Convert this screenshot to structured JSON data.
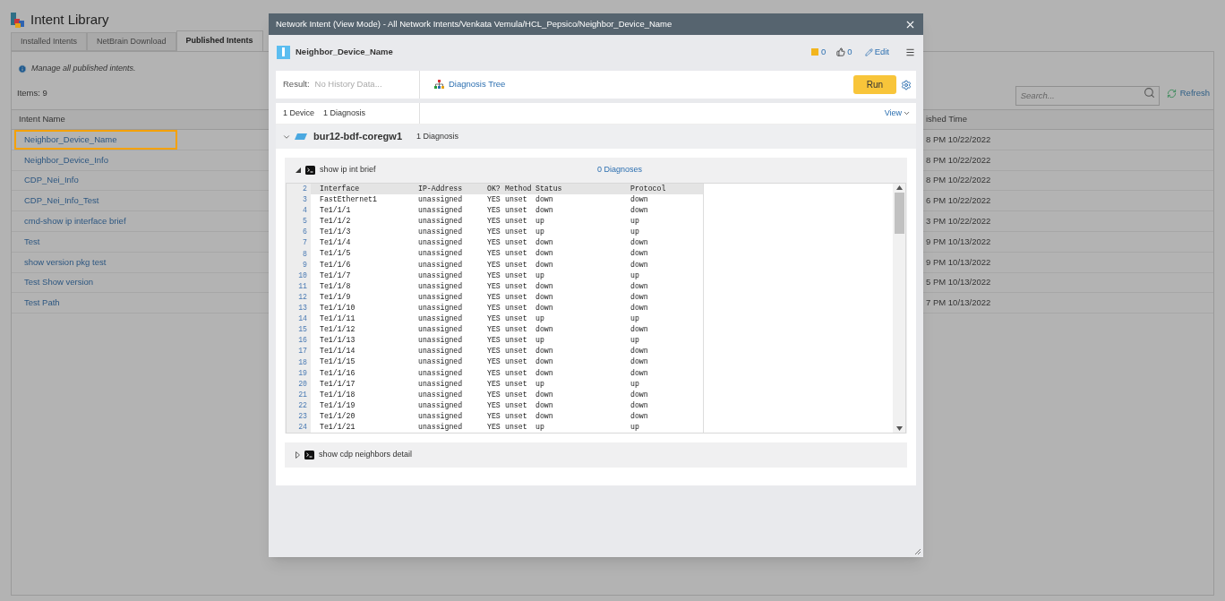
{
  "app": {
    "title": "Intent Library"
  },
  "tabs": [
    {
      "label": "Installed Intents",
      "selected": false
    },
    {
      "label": "NetBrain Download",
      "selected": false
    },
    {
      "label": "Published Intents",
      "selected": true
    }
  ],
  "info": "Manage all published intents.",
  "items": "Items: 9",
  "search": {
    "placeholder": "Search..."
  },
  "refresh": "Refresh",
  "table": {
    "columns": [
      "Intent Name",
      "ished Time"
    ],
    "rows": [
      {
        "name": "Neighbor_Device_Name",
        "selected": true,
        "time": "8 PM 10/22/2022"
      },
      {
        "name": "Neighbor_Device_Info",
        "selected": false,
        "time": "8 PM 10/22/2022"
      },
      {
        "name": "CDP_Nei_Info",
        "selected": false,
        "time": "8 PM 10/22/2022"
      },
      {
        "name": "CDP_Nei_Info_Test",
        "selected": false,
        "time": "6 PM 10/22/2022"
      },
      {
        "name": "cmd-show ip interface brief",
        "selected": false,
        "time": "3 PM 10/22/2022"
      },
      {
        "name": "Test",
        "selected": false,
        "time": "9 PM 10/13/2022"
      },
      {
        "name": "show version pkg test",
        "selected": false,
        "time": "9 PM 10/13/2022"
      },
      {
        "name": "Test Show version",
        "selected": false,
        "time": "5 PM 10/13/2022"
      },
      {
        "name": "Test Path",
        "selected": false,
        "time": "7 PM 10/13/2022"
      }
    ]
  },
  "dialog": {
    "title": "Network Intent (View Mode) - All Network Intents/Venkata Vemula/HCL_Pepsico/Neighbor_Device_Name",
    "intent_name": "Neighbor_Device_Name",
    "comments": "0",
    "likes": "0",
    "edit": "Edit",
    "result_label": "Result:",
    "result_value": "No History Data...",
    "diagnosis_tree": "Diagnosis Tree",
    "run": "Run",
    "summary": [
      "1 Device",
      "1 Diagnosis"
    ],
    "view": "View",
    "device": {
      "name": "bur12-bdf-coregw1",
      "diagnosis": "1 Diagnosis",
      "expanded": true
    },
    "commands": [
      {
        "label": "show ip int brief",
        "expanded": true,
        "diagnoses": "0 Diagnoses",
        "output": {
          "header": {
            "line": "2",
            "cells": [
              "Interface",
              "IP-Address",
              "OK?",
              "Method",
              "Status",
              "Protocol"
            ]
          },
          "rows": [
            {
              "line": "3",
              "cells": [
                "FastEthernet1",
                "unassigned",
                "YES",
                "unset",
                "down",
                "down"
              ]
            },
            {
              "line": "4",
              "cells": [
                "Te1/1/1",
                "unassigned",
                "YES",
                "unset",
                "down",
                "down"
              ]
            },
            {
              "line": "5",
              "cells": [
                "Te1/1/2",
                "unassigned",
                "YES",
                "unset",
                "up",
                "up"
              ]
            },
            {
              "line": "6",
              "cells": [
                "Te1/1/3",
                "unassigned",
                "YES",
                "unset",
                "up",
                "up"
              ]
            },
            {
              "line": "7",
              "cells": [
                "Te1/1/4",
                "unassigned",
                "YES",
                "unset",
                "down",
                "down"
              ]
            },
            {
              "line": "8",
              "cells": [
                "Te1/1/5",
                "unassigned",
                "YES",
                "unset",
                "down",
                "down"
              ]
            },
            {
              "line": "9",
              "cells": [
                "Te1/1/6",
                "unassigned",
                "YES",
                "unset",
                "down",
                "down"
              ]
            },
            {
              "line": "10",
              "cells": [
                "Te1/1/7",
                "unassigned",
                "YES",
                "unset",
                "up",
                "up"
              ]
            },
            {
              "line": "11",
              "cells": [
                "Te1/1/8",
                "unassigned",
                "YES",
                "unset",
                "down",
                "down"
              ]
            },
            {
              "line": "12",
              "cells": [
                "Te1/1/9",
                "unassigned",
                "YES",
                "unset",
                "down",
                "down"
              ]
            },
            {
              "line": "13",
              "cells": [
                "Te1/1/10",
                "unassigned",
                "YES",
                "unset",
                "down",
                "down"
              ]
            },
            {
              "line": "14",
              "cells": [
                "Te1/1/11",
                "unassigned",
                "YES",
                "unset",
                "up",
                "up"
              ]
            },
            {
              "line": "15",
              "cells": [
                "Te1/1/12",
                "unassigned",
                "YES",
                "unset",
                "down",
                "down"
              ]
            },
            {
              "line": "16",
              "cells": [
                "Te1/1/13",
                "unassigned",
                "YES",
                "unset",
                "up",
                "up"
              ]
            },
            {
              "line": "17",
              "cells": [
                "Te1/1/14",
                "unassigned",
                "YES",
                "unset",
                "down",
                "down"
              ]
            },
            {
              "line": "18",
              "cells": [
                "Te1/1/15",
                "unassigned",
                "YES",
                "unset",
                "down",
                "down"
              ]
            },
            {
              "line": "19",
              "cells": [
                "Te1/1/16",
                "unassigned",
                "YES",
                "unset",
                "down",
                "down"
              ]
            },
            {
              "line": "20",
              "cells": [
                "Te1/1/17",
                "unassigned",
                "YES",
                "unset",
                "up",
                "up"
              ]
            },
            {
              "line": "21",
              "cells": [
                "Te1/1/18",
                "unassigned",
                "YES",
                "unset",
                "down",
                "down"
              ]
            },
            {
              "line": "22",
              "cells": [
                "Te1/1/19",
                "unassigned",
                "YES",
                "unset",
                "down",
                "down"
              ]
            },
            {
              "line": "23",
              "cells": [
                "Te1/1/20",
                "unassigned",
                "YES",
                "unset",
                "down",
                "down"
              ]
            },
            {
              "line": "24",
              "cells": [
                "Te1/1/21",
                "unassigned",
                "YES",
                "unset",
                "up",
                "up"
              ]
            }
          ]
        }
      },
      {
        "label": "show cdp neighbors detail",
        "expanded": false
      }
    ]
  }
}
